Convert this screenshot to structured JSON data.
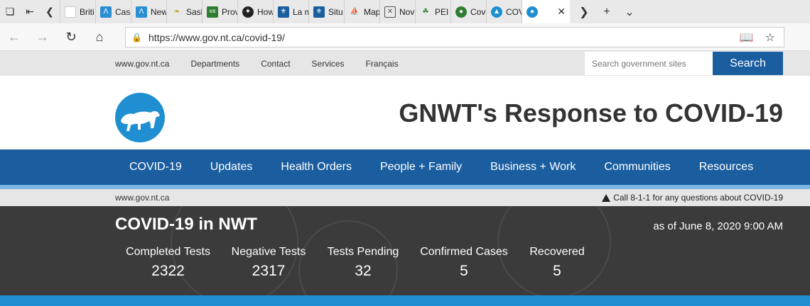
{
  "browser": {
    "tabs": [
      {
        "label": "Briti",
        "color": "#ffffff",
        "icon": "blank-doc-icon"
      },
      {
        "label": "Case",
        "color": "#2a8fd0",
        "icon": "alberta-icon"
      },
      {
        "label": "New",
        "color": "#2a8fd0",
        "icon": "alberta-icon"
      },
      {
        "label": "Sask",
        "color": "#e6c200",
        "icon": "wheat-icon"
      },
      {
        "label": "Prov",
        "color": "#2e7d32",
        "icon": "manitoba-icon"
      },
      {
        "label": "How",
        "color": "#222222",
        "icon": "ontario-icon"
      },
      {
        "label": "La m",
        "color": "#1a5ea0",
        "icon": "quebec-icon"
      },
      {
        "label": "Situ",
        "color": "#1a5ea0",
        "icon": "quebec-icon"
      },
      {
        "label": "Map",
        "color": "#c62828",
        "icon": "nb-icon"
      },
      {
        "label": "Nov",
        "color": "#555555",
        "icon": "ns-icon"
      },
      {
        "label": "PEI (",
        "color": "#2e7d32",
        "icon": "pei-icon"
      },
      {
        "label": "Cov",
        "color": "#2e7d32",
        "icon": "nl-icon"
      },
      {
        "label": "COV",
        "color": "#1f8fd2",
        "icon": "yukon-icon"
      }
    ],
    "url": "https://www.gov.nt.ca/covid-19/"
  },
  "utility": {
    "links": [
      "www.gov.nt.ca",
      "Departments",
      "Contact",
      "Services",
      "Français"
    ],
    "search_placeholder": "Search government sites",
    "search_button": "Search"
  },
  "header": {
    "title": "GNWT's Response to COVID-19"
  },
  "nav": {
    "items": [
      "COVID-19",
      "Updates",
      "Health Orders",
      "People + Family",
      "Business + Work",
      "Communities",
      "Resources"
    ]
  },
  "crumb": {
    "home": "www.gov.nt.ca",
    "alert": "Call 8-1-1 for any questions about COVID-19"
  },
  "stats": {
    "title": "COVID-19 in NWT",
    "date": "as of June 8, 2020 9:00 AM",
    "items": [
      {
        "label": "Completed Tests",
        "value": "2322"
      },
      {
        "label": "Negative Tests",
        "value": "2317"
      },
      {
        "label": "Tests Pending",
        "value": "32"
      },
      {
        "label": "Confirmed Cases",
        "value": "5"
      },
      {
        "label": "Recovered",
        "value": "5"
      }
    ]
  },
  "colors": {
    "brand_blue": "#1a5ea0",
    "light_blue": "#1f8fd2",
    "stats_bg": "#3b3b3b"
  }
}
